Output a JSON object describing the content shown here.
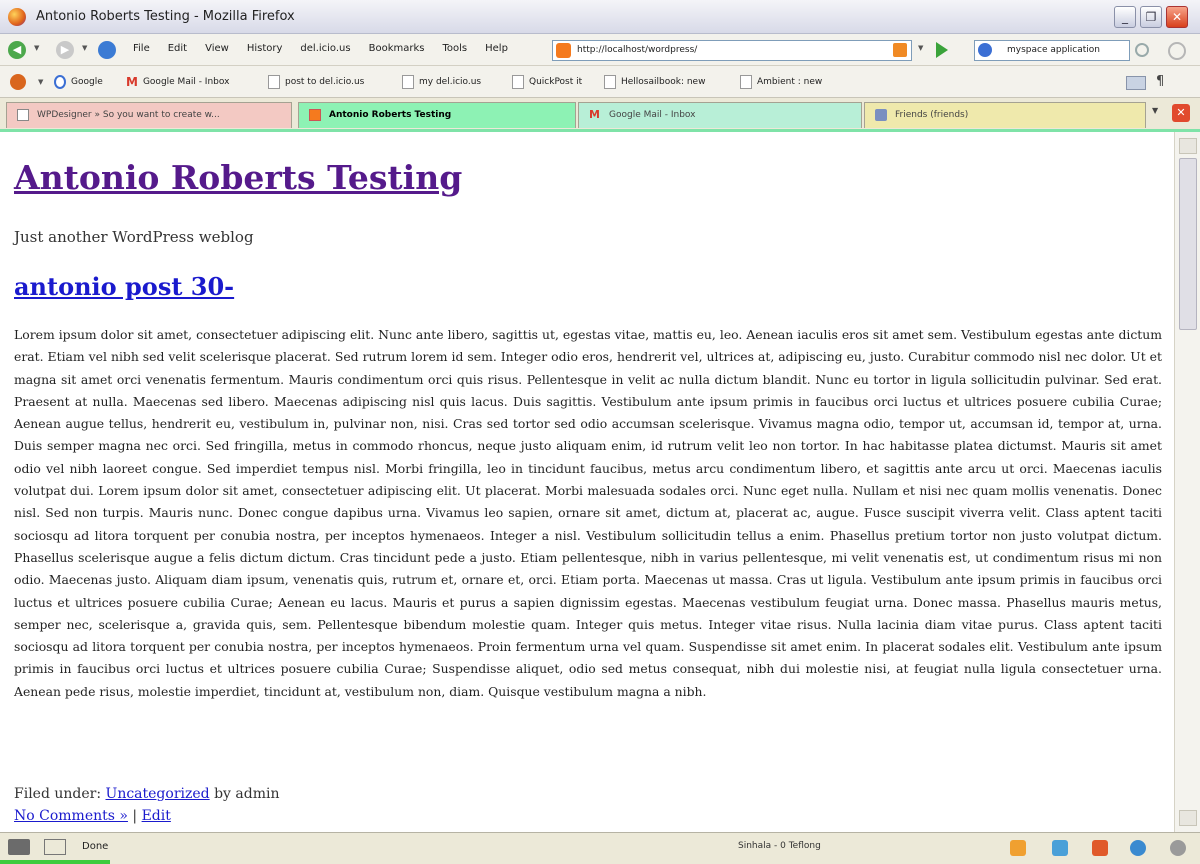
{
  "window": {
    "title": "Antonio Roberts Testing - Mozilla Firefox"
  },
  "menu": [
    "File",
    "Edit",
    "View",
    "History",
    "del.icio.us",
    "Bookmarks",
    "Tools",
    "Help"
  ],
  "address": {
    "url": "http://localhost/wordpress/"
  },
  "search": {
    "value": "myspace application"
  },
  "bookmarks": [
    {
      "label": "Google",
      "icon": "google-icon"
    },
    {
      "label": "Google Mail - Inbox",
      "icon": "gmail-icon"
    },
    {
      "label": "post to del.icio.us",
      "icon": "page-icon"
    },
    {
      "label": "my del.icio.us",
      "icon": "page-icon"
    },
    {
      "label": "QuickPost it",
      "icon": "page-icon"
    },
    {
      "label": "Hellosailbook: new",
      "icon": "page-icon"
    },
    {
      "label": "Ambient : new",
      "icon": "page-icon"
    }
  ],
  "tabs": [
    {
      "label": "WPDesigner » So you want to create w..."
    },
    {
      "label": "Antonio Roberts Testing"
    },
    {
      "label": "Google Mail - Inbox"
    },
    {
      "label": "Friends (friends)"
    }
  ],
  "page": {
    "blog_title": "Antonio Roberts Testing",
    "tagline": "Just another WordPress weblog",
    "post_title": "antonio post 30-",
    "body": "Lorem ipsum dolor sit amet, consectetuer adipiscing elit. Nunc ante libero, sagittis ut, egestas vitae, mattis eu, leo. Aenean iaculis eros sit amet sem. Vestibulum egestas ante dictum erat. Etiam vel nibh sed velit scelerisque placerat. Sed rutrum lorem id sem. Integer odio eros, hendrerit vel, ultrices at, adipiscing eu, justo. Curabitur commodo nisl nec dolor. Ut et magna sit amet orci venenatis fermentum. Mauris condimentum orci quis risus. Pellentesque in velit ac nulla dictum blandit. Nunc eu tortor in ligula sollicitudin pulvinar. Sed erat. Praesent at nulla. Maecenas sed libero. Maecenas adipiscing nisl quis lacus. Duis sagittis. Vestibulum ante ipsum primis in faucibus orci luctus et ultrices posuere cubilia Curae; Aenean augue tellus, hendrerit eu, vestibulum in, pulvinar non, nisi. Cras sed tortor sed odio accumsan scelerisque. Vivamus magna odio, tempor ut, accumsan id, tempor at, urna. Duis semper magna nec orci. Sed fringilla, metus in commodo rhoncus, neque justo aliquam enim, id rutrum velit leo non tortor. In hac habitasse platea dictumst. Mauris sit amet odio vel nibh laoreet congue. Sed imperdiet tempus nisl. Morbi fringilla, leo in tincidunt faucibus, metus arcu condimentum libero, et sagittis ante arcu ut orci. Maecenas iaculis volutpat dui. Lorem ipsum dolor sit amet, consectetuer adipiscing elit. Ut placerat. Morbi malesuada sodales orci. Nunc eget nulla. Nullam et nisi nec quam mollis venenatis. Donec nisl. Sed non turpis. Mauris nunc. Donec congue dapibus urna. Vivamus leo sapien, ornare sit amet, dictum at, placerat ac, augue. Fusce suscipit viverra velit. Class aptent taciti sociosqu ad litora torquent per conubia nostra, per inceptos hymenaeos. Integer a nisl. Vestibulum sollicitudin tellus a enim. Phasellus pretium tortor non justo volutpat dictum. Phasellus scelerisque augue a felis dictum dictum. Cras tincidunt pede a justo. Etiam pellentesque, nibh in varius pellentesque, mi velit venenatis est, ut condimentum risus mi non odio. Maecenas justo. Aliquam diam ipsum, venenatis quis, rutrum et, ornare et, orci. Etiam porta. Maecenas ut massa. Cras ut ligula. Vestibulum ante ipsum primis in faucibus orci luctus et ultrices posuere cubilia Curae; Aenean eu lacus. Mauris et purus a sapien dignissim egestas. Maecenas vestibulum feugiat urna. Donec massa. Phasellus mauris metus, semper nec, scelerisque a, gravida quis, sem. Pellentesque bibendum molestie quam. Integer quis metus. Integer vitae risus. Nulla lacinia diam vitae purus. Class aptent taciti sociosqu ad litora torquent per conubia nostra, per inceptos hymenaeos. Proin fermentum urna vel quam. Suspendisse sit amet enim. In placerat sodales elit. Vestibulum ante ipsum primis in faucibus orci luctus et ultrices posuere cubilia Curae; Suspendisse aliquet, odio sed metus consequat, nibh dui molestie nisi, at feugiat nulla ligula consectetuer urna. Aenean pede risus, molestie imperdiet, tincidunt at, vestibulum non, diam. Quisque vestibulum magna a nibh.",
    "filed_under_prefix": "Filed under:",
    "category": "Uncategorized",
    "by_author": "by admin",
    "comments_link": "No Comments »",
    "separator": "|",
    "edit_link": "Edit"
  },
  "status": {
    "text": "Done",
    "middle": "Sinhala - 0 Teflong"
  },
  "colors": {
    "visited_link": "#551a8b",
    "link": "#1a1acd",
    "active_tab": "#8df2b4"
  }
}
